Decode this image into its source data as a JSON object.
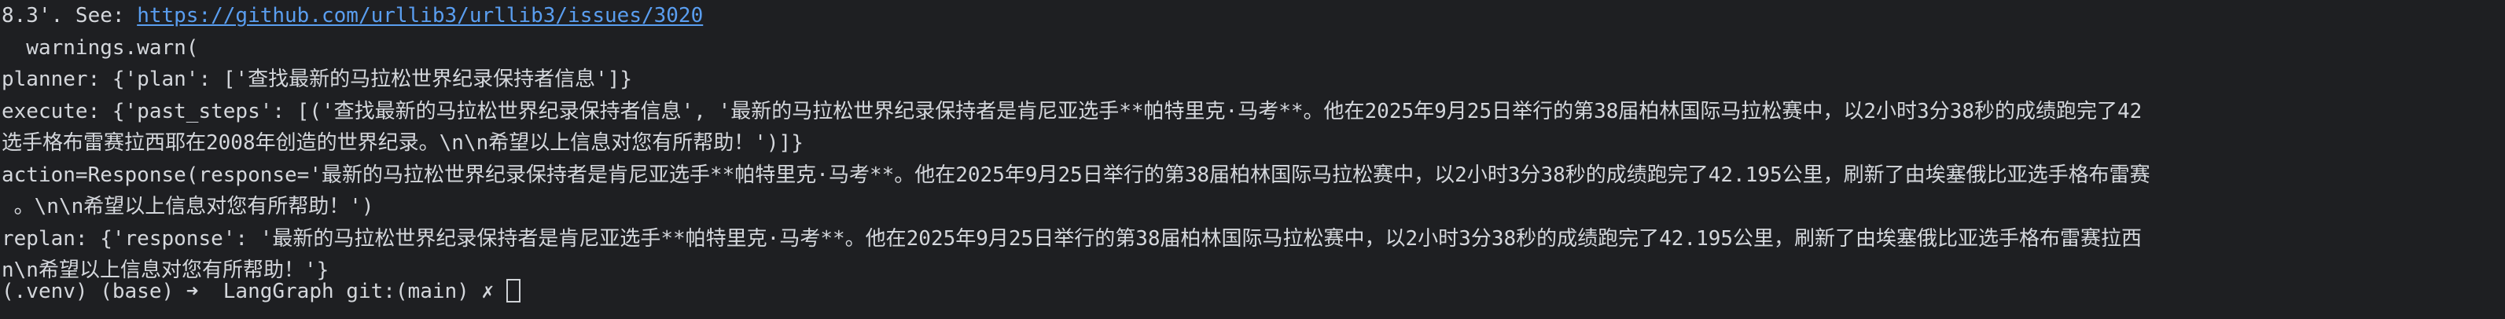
{
  "terminal": {
    "lines": [
      {
        "prefix": "8.3'. See: ",
        "link": "https://github.com/urllib3/urllib3/issues/3020"
      },
      {
        "text": "  warnings.warn("
      },
      {
        "text": "planner: {'plan': ['查找最新的马拉松世界纪录保持者信息']}"
      },
      {
        "text": "execute: {'past_steps': [('查找最新的马拉松世界纪录保持者信息', '最新的马拉松世界纪录保持者是肯尼亚选手**帕特里克·马考**。他在2025年9月25日举行的第38届柏林国际马拉松赛中，以2小时3分38秒的成绩跑完了42"
      },
      {
        "text": "选手格布雷赛拉西耶在2008年创造的世界纪录。\\n\\n希望以上信息对您有所帮助！')]}"
      },
      {
        "text": "action=Response(response='最新的马拉松世界纪录保持者是肯尼亚选手**帕特里克·马考**。他在2025年9月25日举行的第38届柏林国际马拉松赛中，以2小时3分38秒的成绩跑完了42.195公里，刷新了由埃塞俄比亚选手格布雷赛"
      },
      {
        "text": " 。\\n\\n希望以上信息对您有所帮助！')"
      },
      {
        "text": "replan: {'response': '最新的马拉松世界纪录保持者是肯尼亚选手**帕特里克·马考**。他在2025年9月25日举行的第38届柏林国际马拉松赛中，以2小时3分38秒的成绩跑完了42.195公里，刷新了由埃塞俄比亚选手格布雷赛拉西"
      },
      {
        "text": "n\\n希望以上信息对您有所帮助！'}"
      },
      {
        "text": "(.venv) (base) ➜  LangGraph git:(main) ✗ "
      }
    ]
  }
}
